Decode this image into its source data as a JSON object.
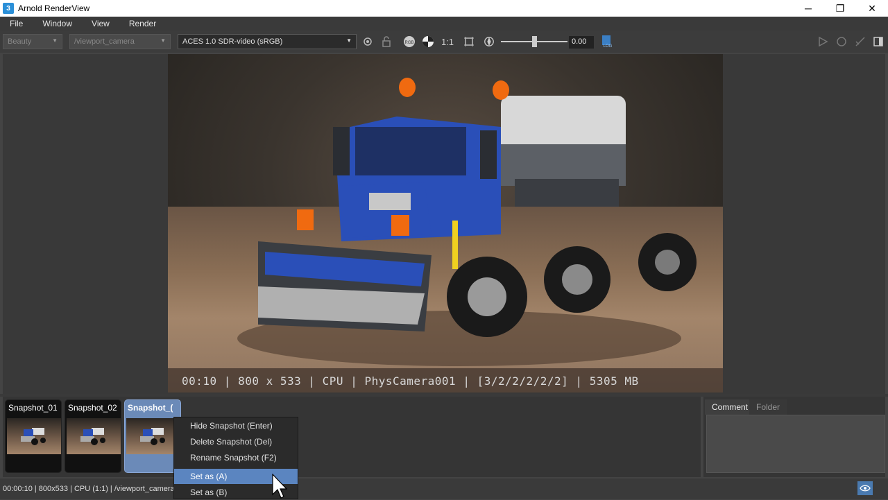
{
  "window": {
    "icon_label": "3",
    "title": "Arnold RenderView",
    "minimize": "─",
    "restore": "❐",
    "close": "✕"
  },
  "menu": [
    "File",
    "Window",
    "View",
    "Render"
  ],
  "toolbar": {
    "aov": "Beauty",
    "camera": "/viewport_camera",
    "color_transform": "ACES 1.0 SDR-video (sRGB)",
    "ratio": "1:1",
    "exposure": "0.00",
    "rgb_label": "RGB",
    "log_label": "LOG"
  },
  "render_info": "00:10 | 800 x 533 | CPU | PhysCamera001 | [3/2/2/2/2/2] | 5305 MB",
  "snapshots": [
    {
      "label": "Snapshot_01",
      "selected": false
    },
    {
      "label": "Snapshot_02",
      "selected": false
    },
    {
      "label": "Snapshot_(",
      "selected": true
    }
  ],
  "side_tabs": [
    "Comment",
    "Folder"
  ],
  "context_menu": [
    {
      "label": "Hide Snapshot  (Enter)",
      "highlighted": false
    },
    {
      "label": "Delete Snapshot  (Del)",
      "highlighted": false
    },
    {
      "label": "Rename Snapshot  (F2)",
      "highlighted": false
    },
    {
      "label": "Set as (A)",
      "highlighted": true
    },
    {
      "label": "Set as (B)",
      "highlighted": false
    }
  ],
  "status": "00:00:10 | 800x533 | CPU (1:1) | /viewport_camera",
  "colors": {
    "accent": "#5b85c0",
    "snapshot_selected": "#6b8ab8",
    "truck_blue": "#2a4fb8",
    "truck_orange": "#f06a10"
  }
}
